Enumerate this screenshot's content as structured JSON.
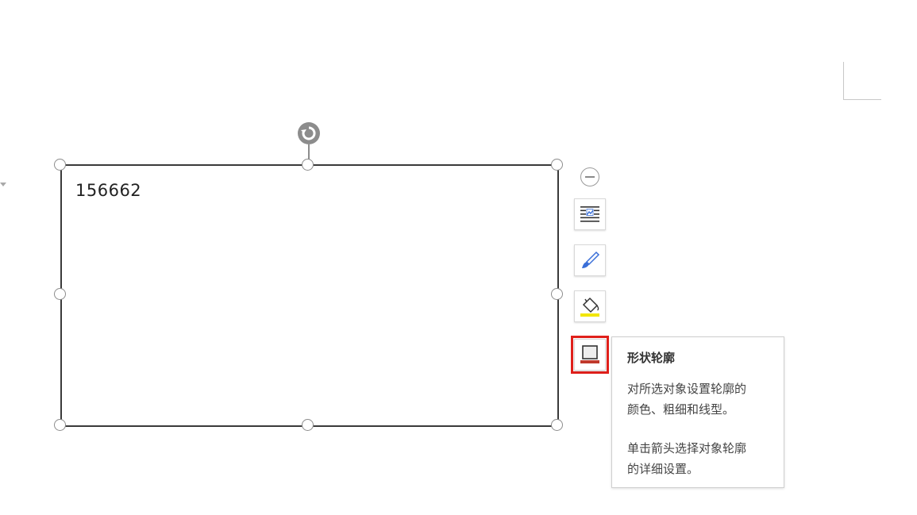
{
  "shape": {
    "text": "156662"
  },
  "side_toolbar": {
    "items": [
      {
        "name": "collapse",
        "icon": "minus-circle-icon"
      },
      {
        "name": "layout-options",
        "icon": "text-wrap-icon"
      },
      {
        "name": "shape-style",
        "icon": "brush-icon"
      },
      {
        "name": "shape-fill",
        "icon": "paint-bucket-icon"
      },
      {
        "name": "shape-outline",
        "icon": "shape-outline-icon",
        "selected": true
      }
    ]
  },
  "tooltip": {
    "title": "形状轮廓",
    "line1": "对所选对象设置轮廓的",
    "line2": "颜色、粗细和线型。",
    "line3": "单击箭头选择对象轮廓",
    "line4": "的详细设置。"
  },
  "colors": {
    "selection_outline": "#e0201b",
    "handle": "#8c8c8c",
    "fill_accent": "#f2e600",
    "icon_blue": "#3a6fd8"
  }
}
